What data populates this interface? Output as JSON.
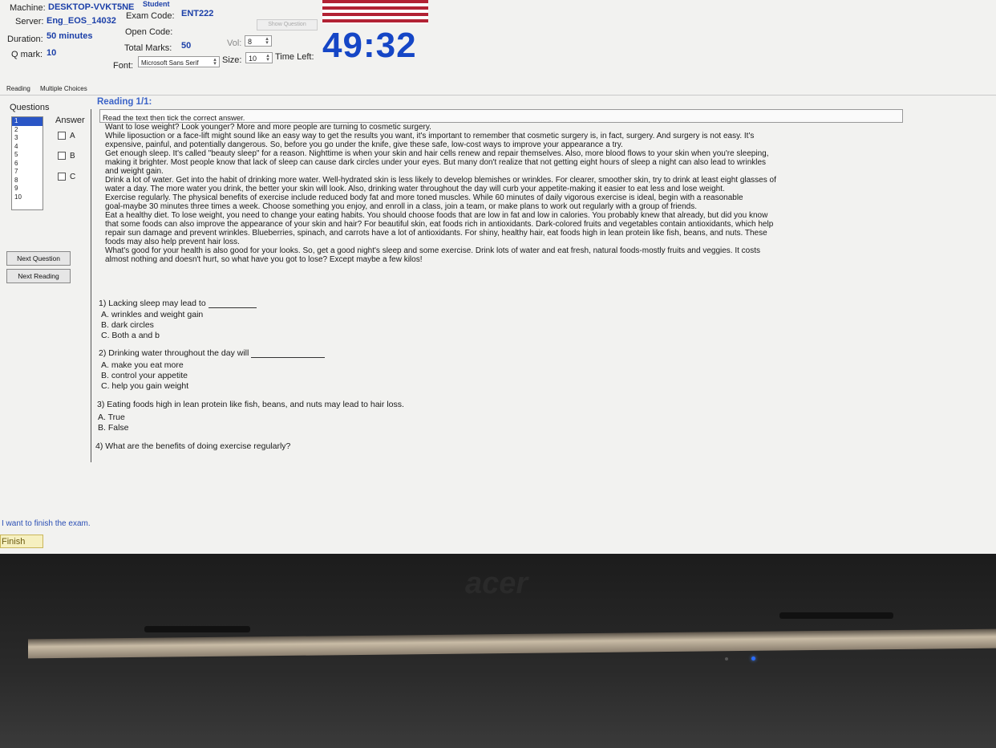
{
  "header": {
    "machine_label": "Machine:",
    "machine_value": "DESKTOP-VVKT5NE",
    "machine_suffix": "Student",
    "server_label": "Server:",
    "server_value": "Eng_EOS_14032",
    "exam_code_label": "Exam Code:",
    "exam_code_value": "ENT222",
    "duration_label": "Duration:",
    "duration_value": "50 minutes",
    "open_code_label": "Open Code:",
    "qmark_label": "Q mark:",
    "qmark_value": "10",
    "total_marks_label": "Total Marks:",
    "total_marks_value": "50",
    "vol_label": "Vol:",
    "vol_value": "8",
    "font_label": "Font:",
    "font_value": "Microsoft Sans Serif",
    "size_label": "Size:",
    "size_value": "10",
    "time_left_label": "Time Left:",
    "time_left_value": "49:32",
    "show_question_label": "Show Question"
  },
  "tabs": [
    "Reading",
    "Multiple Choices"
  ],
  "questions_panel": {
    "title": "Questions",
    "items": [
      "1",
      "2",
      "3",
      "4",
      "5",
      "6",
      "7",
      "8",
      "9",
      "10"
    ],
    "active_index": 0
  },
  "answer_panel": {
    "title": "Answer",
    "options": [
      "A",
      "B",
      "C"
    ]
  },
  "buttons": {
    "next_question": "Next Question",
    "next_reading": "Next Reading",
    "finish": "Finish"
  },
  "finish_note": "I want to finish the exam.",
  "reading": {
    "title": "Reading 1/1:",
    "instruction": "Read the text then tick the correct answer.",
    "lines": [
      "Want to lose weight? Look younger? More and more people are turning to cosmetic surgery.",
      "While liposuction or a face-lift might sound like an easy way to get the results you want, it's important to remember that cosmetic surgery is, in fact, surgery. And surgery is not easy. It's",
      "expensive, painful, and potentially dangerous. So, before you go under the knife, give these safe, low-cost ways to improve your appearance a try.",
      "Get enough sleep. It's called \"beauty sleep\" for a reason. Nighttime is when your skin and hair cells renew and repair themselves. Also, more blood flows to your skin when you're sleeping,",
      "making it brighter. Most people know that lack of sleep can cause dark circles under your eyes. But many don't realize that not getting eight hours of sleep a night can also lead to wrinkles",
      "and weight gain.",
      "Drink a lot of water. Get into the habit of drinking more water. Well-hydrated skin is less likely to develop blemishes or wrinkles. For clearer, smoother skin, try to drink at least eight glasses of",
      "water a day. The more water you drink, the better your skin will look. Also, drinking water throughout the day will curb your appetite-making it easier to eat less and lose weight.",
      "Exercise regularly. The physical benefits of exercise include reduced body fat and more toned muscles. While 60 minutes of daily vigorous exercise is ideal, begin with a reasonable",
      "goal-maybe 30 minutes three times a week. Choose something you enjoy, and enroll in a class, join a team, or make plans to work out regularly with a group of friends.",
      "Eat a healthy diet. To lose weight, you need to change your eating habits. You should choose foods that are low in fat and low in calories. You probably knew that already, but did you know",
      "that some foods can also improve the appearance of your skin and hair? For beautiful skin, eat foods rich in antioxidants. Dark-colored fruits and vegetables contain antioxidants, which help",
      "repair sun damage and prevent wrinkles. Blueberries, spinach, and carrots have a lot of antioxidants. For shiny, healthy hair, eat foods high in lean protein like fish, beans, and nuts. These",
      "foods may also help prevent hair loss.",
      "What's good for your health is also good for your looks. So, get a good night's sleep and some exercise. Drink lots of water and eat fresh, natural foods-mostly fruits and veggies. It costs",
      "almost nothing and doesn't hurt, so what have you got to lose? Except maybe a few kilos!"
    ],
    "questions": [
      {
        "prompt": "1) Lacking sleep may lead to",
        "options": [
          "A. wrinkles and weight gain",
          "B. dark circles",
          "C. Both a and b"
        ]
      },
      {
        "prompt": "2) Drinking water throughout the day will",
        "options": [
          "A. make you eat more",
          "B. control your appetite",
          "C. help you gain weight"
        ]
      },
      {
        "prompt": "3) Eating foods high in lean protein like fish, beans, and nuts may lead to hair loss.",
        "options": [
          "A. True",
          "B. False"
        ]
      },
      {
        "prompt": "4) What are the benefits of doing exercise regularly?",
        "options": []
      }
    ]
  },
  "laptop": {
    "brand": "acer"
  }
}
